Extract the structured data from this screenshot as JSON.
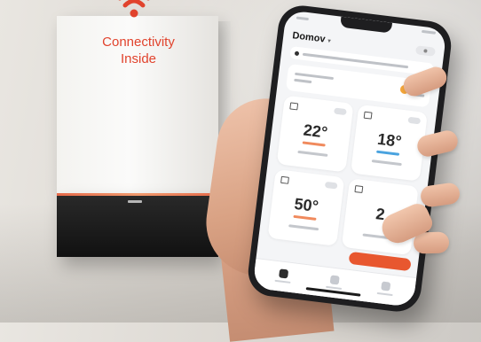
{
  "brand": {
    "logo_line1": "Connectivity",
    "logo_line2": "Inside",
    "accent_color": "#e1432d"
  },
  "app": {
    "home_title": "Domov",
    "action_button_color": "#e8572f",
    "tiles": [
      {
        "value": "22°",
        "accent_color": "#f08a5d"
      },
      {
        "value": "18°",
        "accent_color": "#4aa3df"
      },
      {
        "value": "50°",
        "accent_color": "#f08a5d"
      },
      {
        "value": "2",
        "accent_color": "#f08a5d"
      }
    ],
    "icons": [
      "wifi-icon",
      "sun-icon",
      "home-icon",
      "tab-icon"
    ]
  }
}
